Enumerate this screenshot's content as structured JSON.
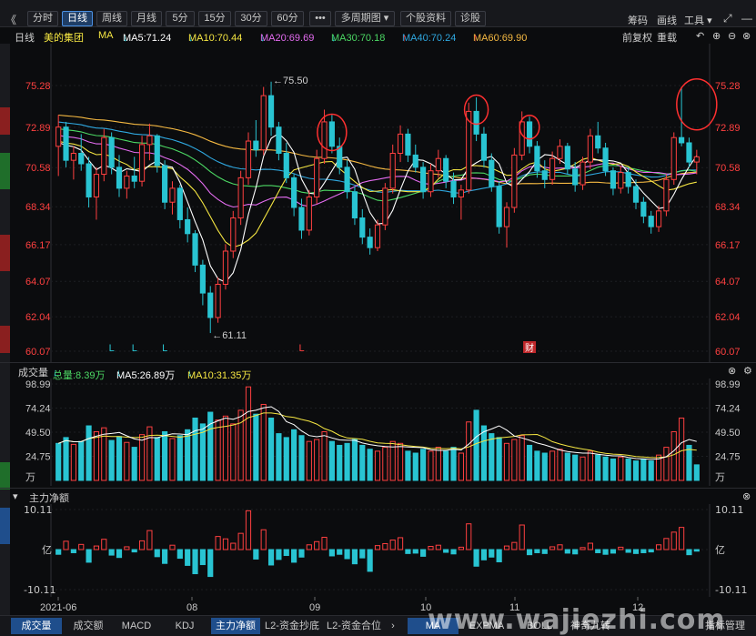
{
  "toolbar": {
    "back": "《",
    "tabs": [
      "分时",
      "日线",
      "周线",
      "月线",
      "5分",
      "15分",
      "30分",
      "60分"
    ],
    "active_tab": "日线",
    "more": "•••",
    "multi_period": "多周期图",
    "stock_info": "个股资料",
    "diagnose": "诊股",
    "right_items": [
      "筹码",
      "画线",
      "工具"
    ]
  },
  "main_legend": {
    "period": "日线",
    "stock_name": "美的集团",
    "ma_label": "MA",
    "ma5": "MA5:71.24",
    "ma10": "MA10:70.44",
    "ma20": "MA20:69.69",
    "ma30": "MA30:70.18",
    "ma40": "MA40:70.24",
    "ma60": "MA60:69.90",
    "adjust": "前复权",
    "overlay": "重载",
    "colors": {
      "ma5": "#ffffff",
      "ma10": "#f5e642",
      "ma20": "#e46cf0",
      "ma30": "#4cd964",
      "ma40": "#2fa8e0",
      "ma60": "#f5b942",
      "up": "#ff4040",
      "down": "#29c4d2"
    }
  },
  "price_axis": [
    "75.28",
    "72.89",
    "70.58",
    "68.34",
    "66.17",
    "64.07",
    "62.04",
    "60.07"
  ],
  "annotations": {
    "high": "←75.50",
    "low": "←61.11",
    "markers": [
      "L",
      "L",
      "L",
      "L"
    ],
    "finance": "财"
  },
  "volume_legend": {
    "title": "成交量",
    "total": "总量:8.39万",
    "ma5": "MA5:26.89万",
    "ma10": "MA10:31.35万"
  },
  "volume_axis": [
    "98.99",
    "74.24",
    "49.50",
    "24.75",
    "万"
  ],
  "flow_legend": {
    "title": "主力净额"
  },
  "flow_axis": [
    "10.11",
    "亿",
    "-10.11"
  ],
  "date_axis": [
    "2021-06",
    "08",
    "09",
    "10",
    "11",
    "12"
  ],
  "bottom_tabs": [
    "成交量",
    "成交额",
    "MACD",
    "KDJ",
    "主力净额",
    "L2-资金抄底",
    "L2-资金合位"
  ],
  "bottom_right_tabs": [
    "MA",
    "EXPMA",
    "BOLL",
    "神奇九转",
    "指标管理"
  ],
  "watermark": "www.wajiezhi.com",
  "chart_data": {
    "type": "bar",
    "title": "美的集团 日线",
    "ylim": [
      60.07,
      75.5
    ],
    "candles": [
      [
        71.8,
        73.6,
        70.1,
        72.9
      ],
      [
        72.9,
        73.2,
        70.6,
        71.0
      ],
      [
        71.0,
        71.8,
        69.9,
        71.4
      ],
      [
        71.4,
        72.5,
        70.4,
        70.8
      ],
      [
        70.8,
        71.2,
        68.3,
        68.9
      ],
      [
        68.9,
        70.6,
        67.6,
        70.2
      ],
      [
        70.2,
        72.8,
        69.8,
        72.3
      ],
      [
        72.3,
        72.6,
        70.2,
        70.6
      ],
      [
        70.6,
        71.3,
        68.9,
        69.4
      ],
      [
        69.4,
        70.4,
        68.8,
        70.1
      ],
      [
        70.1,
        71.2,
        69.4,
        69.8
      ],
      [
        69.8,
        72.4,
        69.5,
        71.9
      ],
      [
        71.9,
        73.1,
        71.0,
        72.4
      ],
      [
        72.4,
        72.5,
        70.3,
        70.7
      ],
      [
        70.7,
        71.0,
        68.2,
        68.6
      ],
      [
        68.6,
        69.8,
        67.9,
        69.4
      ],
      [
        69.4,
        69.6,
        67.1,
        67.6
      ],
      [
        67.6,
        68.3,
        66.3,
        66.8
      ],
      [
        66.8,
        67.0,
        64.6,
        65.0
      ],
      [
        65.0,
        65.3,
        62.7,
        63.4
      ],
      [
        63.4,
        63.8,
        61.11,
        62.0
      ],
      [
        62.0,
        64.3,
        61.7,
        63.9
      ],
      [
        63.9,
        66.2,
        63.6,
        65.8
      ],
      [
        65.8,
        68.1,
        65.4,
        67.7
      ],
      [
        67.7,
        70.4,
        67.3,
        70.0
      ],
      [
        70.0,
        72.6,
        69.6,
        72.1
      ],
      [
        72.1,
        73.3,
        71.2,
        71.6
      ],
      [
        71.6,
        75.2,
        71.3,
        74.7
      ],
      [
        74.7,
        75.5,
        72.4,
        72.9
      ],
      [
        72.9,
        73.2,
        71.0,
        71.4
      ],
      [
        71.4,
        72.0,
        69.7,
        70.0
      ],
      [
        70.0,
        70.2,
        67.8,
        68.3
      ],
      [
        68.3,
        68.8,
        66.5,
        67.0
      ],
      [
        67.0,
        69.3,
        66.7,
        68.9
      ],
      [
        68.9,
        71.6,
        68.5,
        71.1
      ],
      [
        71.1,
        73.9,
        70.8,
        73.2
      ],
      [
        73.2,
        73.6,
        71.4,
        71.8
      ],
      [
        71.8,
        72.3,
        70.2,
        70.6
      ],
      [
        70.6,
        71.0,
        68.8,
        69.2
      ],
      [
        69.2,
        69.5,
        67.3,
        67.7
      ],
      [
        67.7,
        68.2,
        66.2,
        66.6
      ],
      [
        66.6,
        67.1,
        65.6,
        66.0
      ],
      [
        66.0,
        67.6,
        65.8,
        67.3
      ],
      [
        67.3,
        69.7,
        67.0,
        69.4
      ],
      [
        69.4,
        71.9,
        69.1,
        71.4
      ],
      [
        71.4,
        73.0,
        70.9,
        72.5
      ],
      [
        72.5,
        72.8,
        70.9,
        71.3
      ],
      [
        71.3,
        71.9,
        70.3,
        70.6
      ],
      [
        70.6,
        70.9,
        68.8,
        69.2
      ],
      [
        69.2,
        70.8,
        68.9,
        70.4
      ],
      [
        70.4,
        71.6,
        70.0,
        71.1
      ],
      [
        71.1,
        71.3,
        69.4,
        69.8
      ],
      [
        69.8,
        70.3,
        68.5,
        68.9
      ],
      [
        68.9,
        69.6,
        67.6,
        69.3
      ],
      [
        69.3,
        74.3,
        69.1,
        73.8
      ],
      [
        73.8,
        74.6,
        72.1,
        72.5
      ],
      [
        72.5,
        72.9,
        70.6,
        71.0
      ],
      [
        71.0,
        71.4,
        69.2,
        69.5
      ],
      [
        69.5,
        69.8,
        66.8,
        67.2
      ],
      [
        67.2,
        68.6,
        66.0,
        68.3
      ],
      [
        68.3,
        71.7,
        68.0,
        71.3
      ],
      [
        71.3,
        73.8,
        71.0,
        73.2
      ],
      [
        73.2,
        73.5,
        71.4,
        71.8
      ],
      [
        71.8,
        72.1,
        70.0,
        70.4
      ],
      [
        70.4,
        71.0,
        69.4,
        69.9
      ],
      [
        69.9,
        71.5,
        69.6,
        71.1
      ],
      [
        71.1,
        72.2,
        70.8,
        71.8
      ],
      [
        71.8,
        72.0,
        70.2,
        70.5
      ],
      [
        70.5,
        70.9,
        69.2,
        69.6
      ],
      [
        69.6,
        71.2,
        69.3,
        70.9
      ],
      [
        70.9,
        72.8,
        70.5,
        72.4
      ],
      [
        72.4,
        73.2,
        71.4,
        71.7
      ],
      [
        71.7,
        72.0,
        70.1,
        70.4
      ],
      [
        70.4,
        70.6,
        69.0,
        69.4
      ],
      [
        69.4,
        70.7,
        69.1,
        70.3
      ],
      [
        70.3,
        70.6,
        69.1,
        69.5
      ],
      [
        69.5,
        69.9,
        68.2,
        68.6
      ],
      [
        68.6,
        68.9,
        67.4,
        67.8
      ],
      [
        67.8,
        68.1,
        66.8,
        67.2
      ],
      [
        67.2,
        68.4,
        66.9,
        68.1
      ],
      [
        68.1,
        70.2,
        67.8,
        69.9
      ],
      [
        69.9,
        72.6,
        69.6,
        72.3
      ],
      [
        72.3,
        75.2,
        71.8,
        72.0
      ],
      [
        72.0,
        72.3,
        70.6,
        70.9
      ],
      [
        70.9,
        71.6,
        70.2,
        71.2
      ]
    ],
    "volumes": [
      [
        38,
        "down"
      ],
      [
        44,
        "down"
      ],
      [
        37,
        "up"
      ],
      [
        40,
        "down"
      ],
      [
        56,
        "down"
      ],
      [
        50,
        "up"
      ],
      [
        54,
        "up"
      ],
      [
        41,
        "down"
      ],
      [
        45,
        "down"
      ],
      [
        39,
        "up"
      ],
      [
        34,
        "down"
      ],
      [
        47,
        "up"
      ],
      [
        55,
        "up"
      ],
      [
        44,
        "down"
      ],
      [
        50,
        "down"
      ],
      [
        43,
        "up"
      ],
      [
        46,
        "down"
      ],
      [
        52,
        "down"
      ],
      [
        64,
        "down"
      ],
      [
        58,
        "down"
      ],
      [
        70,
        "down"
      ],
      [
        62,
        "up"
      ],
      [
        66,
        "up"
      ],
      [
        58,
        "up"
      ],
      [
        72,
        "up"
      ],
      [
        96,
        "up"
      ],
      [
        68,
        "down"
      ],
      [
        78,
        "up"
      ],
      [
        64,
        "down"
      ],
      [
        48,
        "down"
      ],
      [
        44,
        "down"
      ],
      [
        52,
        "down"
      ],
      [
        46,
        "down"
      ],
      [
        40,
        "up"
      ],
      [
        42,
        "up"
      ],
      [
        50,
        "up"
      ],
      [
        40,
        "down"
      ],
      [
        36,
        "down"
      ],
      [
        38,
        "down"
      ],
      [
        42,
        "down"
      ],
      [
        36,
        "down"
      ],
      [
        32,
        "down"
      ],
      [
        30,
        "up"
      ],
      [
        34,
        "up"
      ],
      [
        40,
        "up"
      ],
      [
        38,
        "up"
      ],
      [
        30,
        "down"
      ],
      [
        28,
        "down"
      ],
      [
        32,
        "down"
      ],
      [
        30,
        "up"
      ],
      [
        34,
        "up"
      ],
      [
        30,
        "down"
      ],
      [
        34,
        "down"
      ],
      [
        28,
        "up"
      ],
      [
        60,
        "up"
      ],
      [
        72,
        "down"
      ],
      [
        56,
        "down"
      ],
      [
        48,
        "down"
      ],
      [
        44,
        "down"
      ],
      [
        38,
        "up"
      ],
      [
        42,
        "up"
      ],
      [
        46,
        "up"
      ],
      [
        36,
        "down"
      ],
      [
        30,
        "down"
      ],
      [
        28,
        "down"
      ],
      [
        30,
        "up"
      ],
      [
        32,
        "up"
      ],
      [
        28,
        "down"
      ],
      [
        26,
        "down"
      ],
      [
        24,
        "up"
      ],
      [
        30,
        "up"
      ],
      [
        26,
        "down"
      ],
      [
        24,
        "down"
      ],
      [
        22,
        "down"
      ],
      [
        24,
        "up"
      ],
      [
        22,
        "down"
      ],
      [
        20,
        "down"
      ],
      [
        22,
        "down"
      ],
      [
        20,
        "down"
      ],
      [
        26,
        "up"
      ],
      [
        34,
        "up"
      ],
      [
        50,
        "up"
      ],
      [
        64,
        "up"
      ],
      [
        36,
        "down"
      ],
      [
        16,
        "down"
      ]
    ],
    "net_flow": [
      [
        -1.2,
        "down"
      ],
      [
        2.1,
        "up"
      ],
      [
        -0.8,
        "down"
      ],
      [
        1.3,
        "up"
      ],
      [
        -3.2,
        "down"
      ],
      [
        0.9,
        "up"
      ],
      [
        2.6,
        "up"
      ],
      [
        -1.4,
        "down"
      ],
      [
        -2.0,
        "down"
      ],
      [
        0.7,
        "up"
      ],
      [
        -0.6,
        "down"
      ],
      [
        2.2,
        "up"
      ],
      [
        4.8,
        "up"
      ],
      [
        -1.8,
        "down"
      ],
      [
        -3.5,
        "down"
      ],
      [
        1.1,
        "up"
      ],
      [
        -2.2,
        "down"
      ],
      [
        -4.0,
        "down"
      ],
      [
        -6.1,
        "down"
      ],
      [
        -3.8,
        "down"
      ],
      [
        -6.8,
        "down"
      ],
      [
        3.3,
        "up"
      ],
      [
        2.7,
        "up"
      ],
      [
        1.6,
        "up"
      ],
      [
        4.1,
        "up"
      ],
      [
        9.8,
        "up"
      ],
      [
        -2.4,
        "down"
      ],
      [
        5.0,
        "up"
      ],
      [
        -3.9,
        "down"
      ],
      [
        -2.5,
        "down"
      ],
      [
        -1.5,
        "down"
      ],
      [
        -3.2,
        "down"
      ],
      [
        -1.9,
        "down"
      ],
      [
        1.2,
        "up"
      ],
      [
        2.0,
        "up"
      ],
      [
        3.1,
        "up"
      ],
      [
        -1.6,
        "down"
      ],
      [
        -1.2,
        "down"
      ],
      [
        -2.3,
        "down"
      ],
      [
        -3.6,
        "down"
      ],
      [
        -2.1,
        "down"
      ],
      [
        -5.5,
        "down"
      ],
      [
        1.0,
        "up"
      ],
      [
        1.5,
        "up"
      ],
      [
        2.4,
        "up"
      ],
      [
        3.0,
        "up"
      ],
      [
        -1.0,
        "down"
      ],
      [
        -0.9,
        "down"
      ],
      [
        -1.7,
        "down"
      ],
      [
        0.8,
        "up"
      ],
      [
        1.1,
        "up"
      ],
      [
        -0.7,
        "down"
      ],
      [
        -1.1,
        "down"
      ],
      [
        0.6,
        "up"
      ],
      [
        6.5,
        "up"
      ],
      [
        -4.2,
        "down"
      ],
      [
        -2.6,
        "down"
      ],
      [
        -1.9,
        "down"
      ],
      [
        -3.1,
        "down"
      ],
      [
        0.9,
        "up"
      ],
      [
        1.8,
        "up"
      ],
      [
        6.2,
        "up"
      ],
      [
        -1.3,
        "down"
      ],
      [
        -0.8,
        "down"
      ],
      [
        -1.0,
        "down"
      ],
      [
        0.7,
        "up"
      ],
      [
        1.2,
        "up"
      ],
      [
        -0.9,
        "down"
      ],
      [
        -1.1,
        "down"
      ],
      [
        0.5,
        "up"
      ],
      [
        1.6,
        "up"
      ],
      [
        -0.8,
        "down"
      ],
      [
        -1.2,
        "down"
      ],
      [
        -0.9,
        "down"
      ],
      [
        0.6,
        "up"
      ],
      [
        -0.7,
        "down"
      ],
      [
        -1.0,
        "down"
      ],
      [
        -0.8,
        "down"
      ],
      [
        -0.6,
        "down"
      ],
      [
        1.2,
        "up"
      ],
      [
        2.8,
        "up"
      ],
      [
        4.4,
        "up"
      ],
      [
        5.6,
        "up"
      ],
      [
        -1.3,
        "down"
      ],
      [
        -0.4,
        "down"
      ]
    ]
  }
}
